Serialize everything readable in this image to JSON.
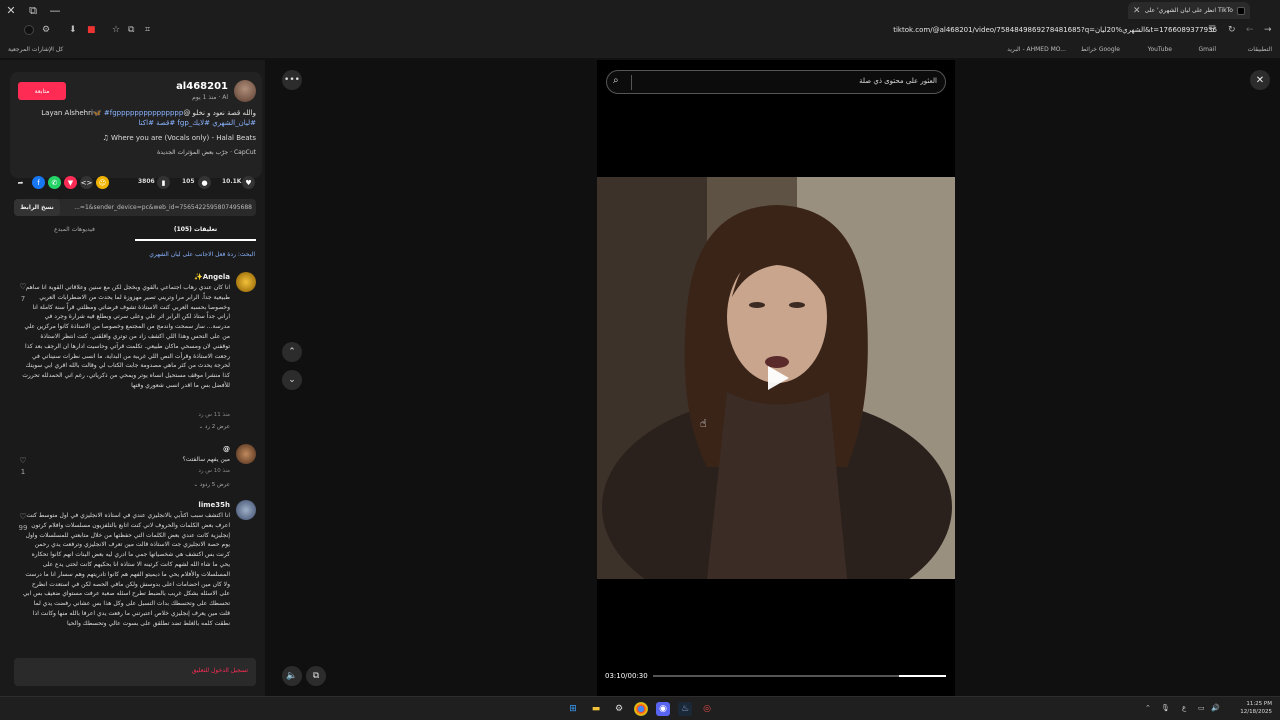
{
  "browser": {
    "tab_title": "انظر على ليان الشهري' على TikTok",
    "url": "tiktok.com/@al468201/video/7584849869278481685?q=الشهري%20ليان&t=1766089377936",
    "bookmarks_left": "كل الإشارات المرجعية",
    "bookmarks": [
      "التطبيقات",
      "Gmail",
      "YouTube",
      "خرائط Google",
      "البريد - AHMED MO..."
    ]
  },
  "video_panel": {
    "username": "al468201",
    "meta": "Al · منذ 1 يوم",
    "follow_label": "متابعة",
    "description_text": "والله قصة نعود و نخلو @Layan Alshehri🦋",
    "description_tags": "#fgppppppppppppppp #ليان_الشهري #لايك_fgp #قصة #اكتا",
    "music": "♫ Where you are (Vocals only) - Halal Beats",
    "capcut": "CapCut · جرّب بعض المؤثرات الجديدة",
    "likes": "10.1K",
    "comments_count": "105",
    "saves": "3806",
    "copy_link_label": "نسخ الرابط",
    "link_text": "...=1&sender_device=pc&web_id=7565422595807495688",
    "tab_creator_videos": "فيديوهات المبدع",
    "tab_comments": "(105) تعليقات",
    "search_suggestion": "البحث: ردة فعل الاجانب على ليان الشهري",
    "login_prompt": "تسجيل الدخول للتعليق"
  },
  "comments": [
    {
      "name": "Angela✨",
      "text": "انا كان عندي رهاب اجتماعي بالقوي وبخجل لكن مع سنين وعلاقاتي القوية انا ساهم طبيعية جداً. الرابر مرا وتريني تصير مهزوزة لما يحدث من الاضطرابات العربي وخصوصا بحسبه العربي كنت الاستاذة تشوف فرضاتي ومظلتي قراً سنة كاملة انا اراني جداً ستاذ لكن الرابر اثر علي وعلى سرتي وبطلع فيه شرارة وجرد في مدرسة... ساز سمحت واندمج من المجتمع وخصوصا من الاستاذة كانوا مركزين علي من على التحس وهذا اللي اكشف زاد من توتري واقلقني. كنت انتظر الاستاذة توقفني لان ومسحي ماكان طبيعي. تكلمت قرآتي وحاسيت ادارها ان الرجف بعد كذا رجعت الاستاذة وقرأت النص اللي غريبة من البداية. ما انسى نظرات سنيناتي في لحرجة يحدث من كثر ماهي مصدومة جابت الكتاب لي وقالت بالله اقري ابي سويتك كذا منشرا موقف مستحيل انساه يوتر ويمحي من ذكرياتي، رغم اني الحمدلله تحررت للأفضل بس ما اقدر انسى شعوري وقتها",
      "meta": "منذ 11 س   رد",
      "replies": "عرض 2 رد ⌄",
      "likes": "7"
    },
    {
      "name": "@",
      "text": "مين يفهم سالفتت؟",
      "meta": "منذ 10 س   رد",
      "replies": "عرض 5 ردود ⌄",
      "likes": "1"
    },
    {
      "name": "lime35h",
      "text": "انا اكتشف سبب اكتآبي بالانجليزي عندي في استاذه الانجليزي في اول متوسط كنت اعرف بعض الكلمات والحروف لاني كنت اتابع بالتلفزيون مسلسلات وافلام كرتون إنجليزية كانت عندي بعض الكلمات التي حفظتها من خلال متابعتي للمسلسلات واول يوم حصة الانجليزي جت الاستاذه قالت مين تعرف الانجليزي وترفعت يدي رحمن كرنت بس اكتشف هي شخصياتها جمي ما ادري ليه بعض البنات انهم كانوا تحكاره يحي ما شاء الله لشهم كانت كرتينه الا ستاذه انا بحكيهم كانت لحتى يدع على المسلسلات والأفلام يحي ما ديميتو الفهم هم كانوا تادريتهم وهم سسار انا ما درست ولا كان مين احضامات اعلى بدوسش ولكن مافي الحصه لكن في استعدت انظرح على الاسئله بشكل غريب بالضبط تطرح اسئله صعبة عرفت مستواي ضعيف بس ابي تحسطك على وتحسطك بدات التسبل على وكل هذا بس عشاني رفضت يدي لما قلت مين يعرف إنجليزي خلاص اعتبرتني ما رفعت يدي اعرفا بالله منها وكانت اذا نطقت كلمه بالغلط تضد تطلقق على بسوت عالي وتحسطك والحيا",
      "meta": "",
      "replies": "",
      "likes": "99"
    }
  ],
  "stage": {
    "search_text": "العثور على محتوى ذي صلة",
    "timecode": "03:10/00:30",
    "progress": 0.84
  },
  "taskbar": {
    "time": "11:25 PM",
    "date": "12/18/2025",
    "lang": "ع"
  },
  "colors": {
    "accent": "#fe2c55",
    "link": "#8ab4ff"
  }
}
